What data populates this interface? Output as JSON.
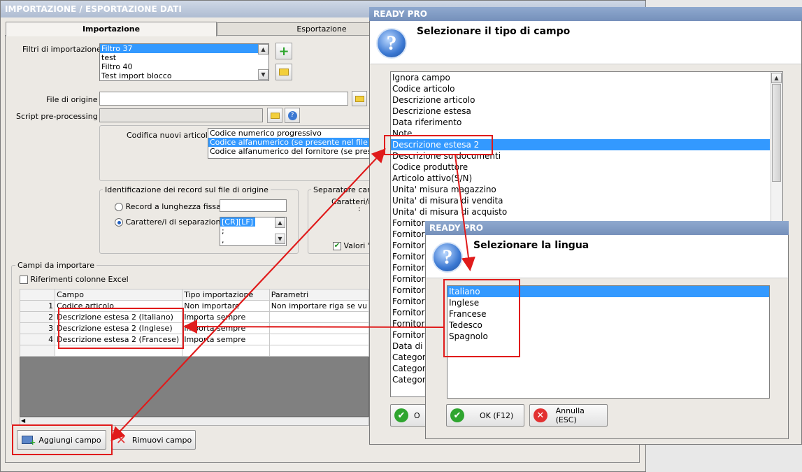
{
  "main_window": {
    "title": "IMPORTAZIONE / ESPORTAZIONE DATI",
    "tabs": [
      "Importazione",
      "Esportazione"
    ],
    "filters_label": "Filtri di importazione :",
    "filters": [
      "Filtro 37",
      "test",
      "Filtro 40",
      "Test import blocco"
    ],
    "file_origin_label": "File di origine :",
    "script_label": "Script pre-processing :",
    "coding_label": "Codifica nuovi articoli :",
    "coding_options": [
      "Codice numerico progressivo",
      "Codice alfanumerico (se presente nel file di input",
      "Codice alfanumerico del fornitore (se presente"
    ],
    "ident_group": "Identificazione dei record sul file di origine",
    "radio_fixed": "Record a lunghezza fissa",
    "radio_sep": "Carattere/i di separazione",
    "separators": [
      "[CR][LF]",
      ";",
      ","
    ],
    "sep_group": "Separatore camp",
    "sep_chars": "Caratteri/i",
    "sep_colon": ":",
    "valori_label": "Valori 's",
    "fields_group": "Campi da importare",
    "excel_refs": "Riferimenti colonne Excel",
    "grid_headers": [
      "Campo",
      "Tipo importazione",
      "Parametri"
    ],
    "grid_rows": [
      {
        "n": "1",
        "campo": "Codice articolo",
        "tipo": "Non importare",
        "param": "Non importare riga se vu"
      },
      {
        "n": "2",
        "campo": "Descrizione estesa 2 (Italiano)",
        "tipo": "Importa sempre",
        "param": ""
      },
      {
        "n": "3",
        "campo": "Descrizione estesa 2 (Inglese)",
        "tipo": "Importa sempre",
        "param": ""
      },
      {
        "n": "4",
        "campo": "Descrizione estesa 2 (Francese)",
        "tipo": "Importa sempre",
        "param": ""
      }
    ],
    "add_field": "Aggiungi campo",
    "remove_field": "Rimuovi campo"
  },
  "dialog_field": {
    "title": "READY PRO",
    "heading": "Selezionare il tipo di campo",
    "items": [
      "Ignora campo",
      "Codice articolo",
      "Descrizione articolo",
      "Descrizione estesa",
      "Data riferimento",
      "Note",
      "Descrizione estesa 2",
      "Descrizione su documenti",
      "Codice produttore",
      "Articolo attivo(S/N)",
      "Unita' misura magazzino",
      "Unita' di misura di vendita",
      "Unita' di misura di acquisto",
      "Fornitore",
      "Fornitore",
      "Fornitore",
      "Fornitore",
      "Fornitore",
      "Fornitore",
      "Fornitore",
      "Fornitore",
      "Fornitore",
      "Fornitore",
      "Fornitore",
      "Data di a",
      "Categori",
      "Categori",
      "Categori"
    ],
    "selected_index": 6,
    "ok_partial": "O"
  },
  "dialog_lang": {
    "title": "READY PRO",
    "heading": "Selezionare la lingua",
    "items": [
      "Italiano",
      "Inglese",
      "Francese",
      "Tedesco",
      "Spagnolo"
    ],
    "selected_index": 0,
    "ok": "OK (F12)",
    "cancel": "Annulla (ESC)"
  },
  "colors": {
    "highlight": "#e01b1b",
    "selection": "#3399ff",
    "title_bar": "#8aa5cc"
  }
}
